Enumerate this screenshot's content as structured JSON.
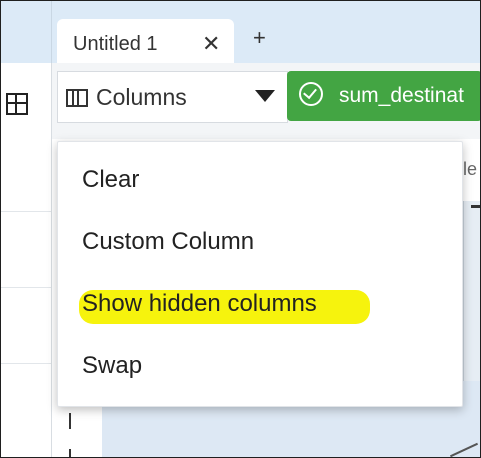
{
  "tabs": {
    "active_tab_label": "Untitled 1",
    "close_symbol": "✕",
    "new_tab_symbol": "+"
  },
  "toolbar": {
    "columns_label": "Columns",
    "chip_label": "sum_destinat"
  },
  "background": {
    "partial_text": "le"
  },
  "menu": {
    "items": [
      {
        "label": "Clear"
      },
      {
        "label": "Custom Column"
      },
      {
        "label": "Show hidden columns",
        "highlighted": true
      },
      {
        "label": "Swap"
      }
    ]
  },
  "colors": {
    "chip_green": "#43a543",
    "highlight_yellow": "#f6f200",
    "tabstrip_blue": "#dceaf7"
  }
}
